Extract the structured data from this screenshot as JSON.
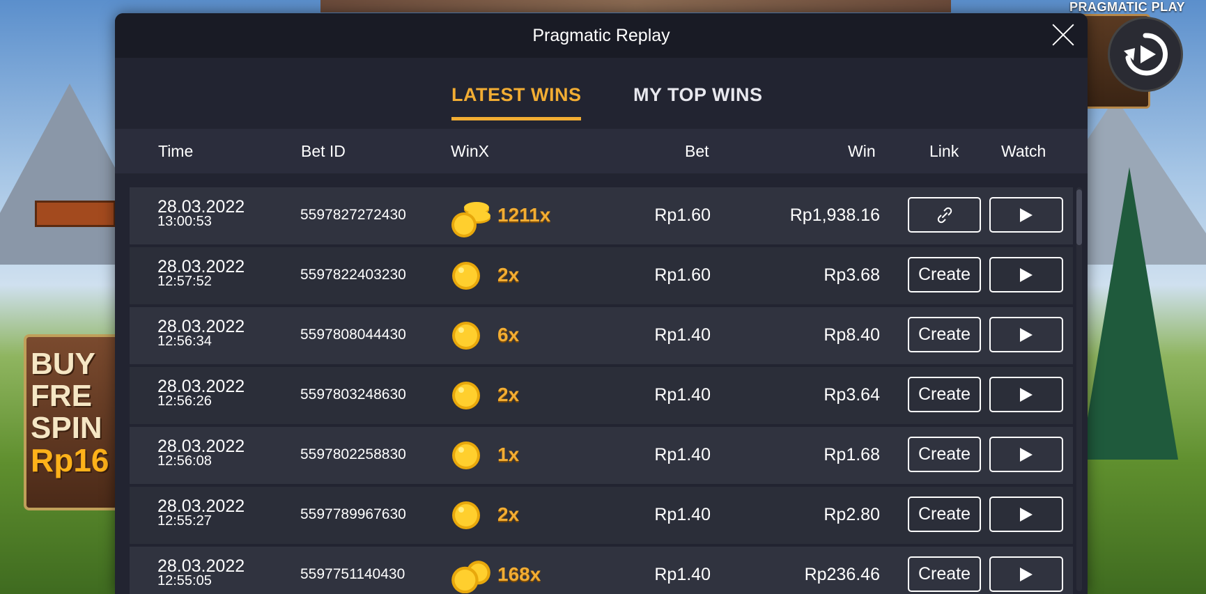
{
  "background": {
    "brand": "PRAGMATIC PLAY",
    "buy_text_lines": [
      "BUY",
      "FRE",
      "SPIN"
    ],
    "buy_price": "Rp16"
  },
  "modal": {
    "title": "Pragmatic Replay",
    "tabs": [
      {
        "label": "LATEST WINS",
        "active": true
      },
      {
        "label": "MY TOP WINS",
        "active": false
      }
    ],
    "columns": {
      "time": "Time",
      "bet_id": "Bet ID",
      "winx": "WinX",
      "bet": "Bet",
      "win": "Win",
      "link": "Link",
      "watch": "Watch"
    },
    "rows": [
      {
        "date": "28.03.2022",
        "time": "13:00:53",
        "bet_id": "5597827272430",
        "winx": "1211x",
        "coin": "stack",
        "bet": "Rp1.60",
        "win": "Rp1,938.16",
        "link": "",
        "link_icon": "link-icon"
      },
      {
        "date": "28.03.2022",
        "time": "12:57:52",
        "bet_id": "5597822403230",
        "winx": "2x",
        "coin": "single",
        "bet": "Rp1.60",
        "win": "Rp3.68",
        "link": "Create"
      },
      {
        "date": "28.03.2022",
        "time": "12:56:34",
        "bet_id": "5597808044430",
        "winx": "6x",
        "coin": "single",
        "bet": "Rp1.40",
        "win": "Rp8.40",
        "link": "Create"
      },
      {
        "date": "28.03.2022",
        "time": "12:56:26",
        "bet_id": "5597803248630",
        "winx": "2x",
        "coin": "single",
        "bet": "Rp1.40",
        "win": "Rp3.64",
        "link": "Create"
      },
      {
        "date": "28.03.2022",
        "time": "12:56:08",
        "bet_id": "5597802258830",
        "winx": "1x",
        "coin": "single",
        "bet": "Rp1.40",
        "win": "Rp1.68",
        "link": "Create"
      },
      {
        "date": "28.03.2022",
        "time": "12:55:27",
        "bet_id": "5597789967630",
        "winx": "2x",
        "coin": "single",
        "bet": "Rp1.40",
        "win": "Rp2.80",
        "link": "Create"
      },
      {
        "date": "28.03.2022",
        "time": "12:55:05",
        "bet_id": "5597751140430",
        "winx": "168x",
        "coin": "double",
        "bet": "Rp1.40",
        "win": "Rp236.46",
        "link": "Create"
      }
    ]
  },
  "colors": {
    "accent": "#f2ad33",
    "modal_bg": "#222431",
    "header_bg": "#191b25",
    "row_bg": "#30333f"
  }
}
